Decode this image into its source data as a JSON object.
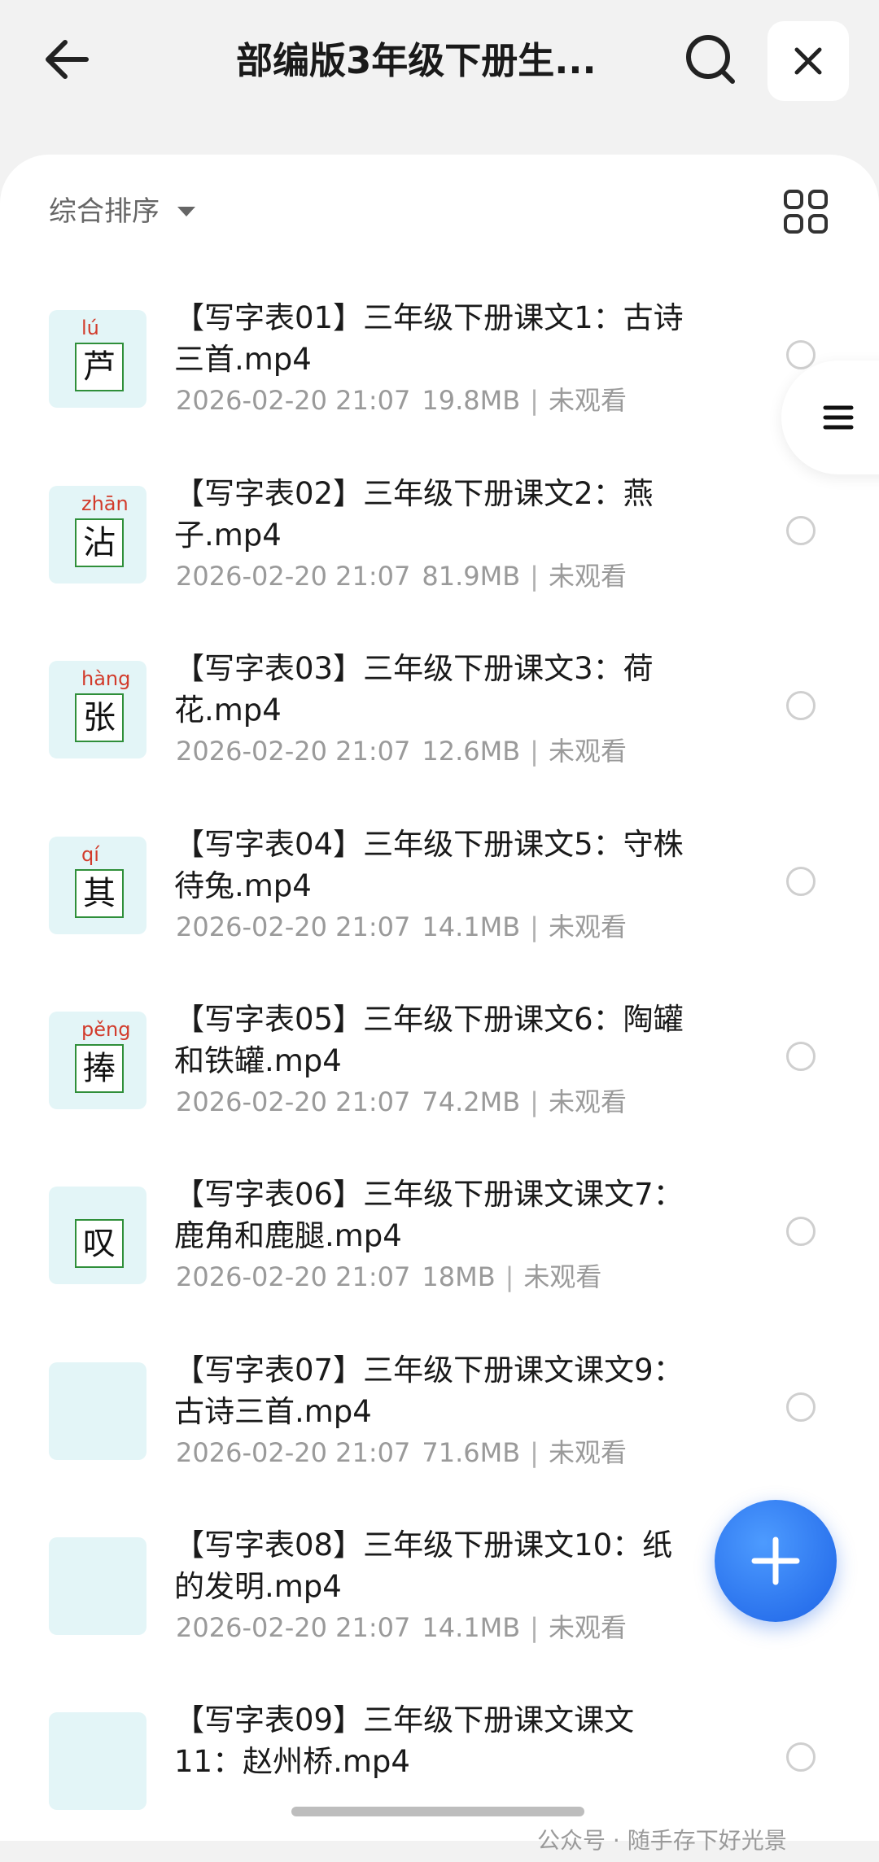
{
  "header": {
    "title": "部编版3年级下册生...",
    "back_icon": "back-arrow-icon",
    "search_icon": "search-icon",
    "close_icon": "close-icon"
  },
  "toolbar": {
    "sort_label": "综合排序",
    "grid_icon": "grid-view-icon"
  },
  "items": [
    {
      "title": "【写字表01】三年级下册课文1：古诗三首.mp4",
      "date": "2026-02-20 21:07",
      "size": "19.8MB",
      "status": "未观看",
      "pinyin": "lú",
      "char": "芦"
    },
    {
      "title": "【写字表02】三年级下册课文2：燕子.mp4",
      "date": "2026-02-20 21:07",
      "size": "81.9MB",
      "status": "未观看",
      "pinyin": "zhān",
      "char": "沾"
    },
    {
      "title": "【写字表03】三年级下册课文3：荷花.mp4",
      "date": "2026-02-20 21:07",
      "size": "12.6MB",
      "status": "未观看",
      "pinyin": "hàng",
      "char": "张"
    },
    {
      "title": "【写字表04】三年级下册课文5：守株待兔.mp4",
      "date": "2026-02-20 21:07",
      "size": "14.1MB",
      "status": "未观看",
      "pinyin": "qí",
      "char": "其"
    },
    {
      "title": "【写字表05】三年级下册课文6：陶罐和铁罐.mp4",
      "date": "2026-02-20 21:07",
      "size": "74.2MB",
      "status": "未观看",
      "pinyin": "pěng",
      "char": "捧"
    },
    {
      "title": "【写字表06】三年级下册课文课文7：鹿角和鹿腿.mp4",
      "date": "2026-02-20 21:07",
      "size": "18MB",
      "status": "未观看",
      "pinyin": "",
      "char": "叹"
    },
    {
      "title": "【写字表07】三年级下册课文课文9：古诗三首.mp4",
      "date": "2026-02-20 21:07",
      "size": "71.6MB",
      "status": "未观看",
      "pinyin": "",
      "char": ""
    },
    {
      "title": "【写字表08】三年级下册课文10：纸的发明.mp4",
      "date": "2026-02-20 21:07",
      "size": "14.1MB",
      "status": "未观看",
      "pinyin": "",
      "char": ""
    },
    {
      "title": "【写字表09】三年级下册课文课文11：赵州桥.mp4",
      "date": "",
      "size": "",
      "status": "",
      "pinyin": "",
      "char": ""
    }
  ],
  "meta_separator": "|",
  "side_menu_icon": "menu-lines-icon",
  "fab_icon": "plus-icon",
  "watermark": "公众号 · 随手存下好光景"
}
